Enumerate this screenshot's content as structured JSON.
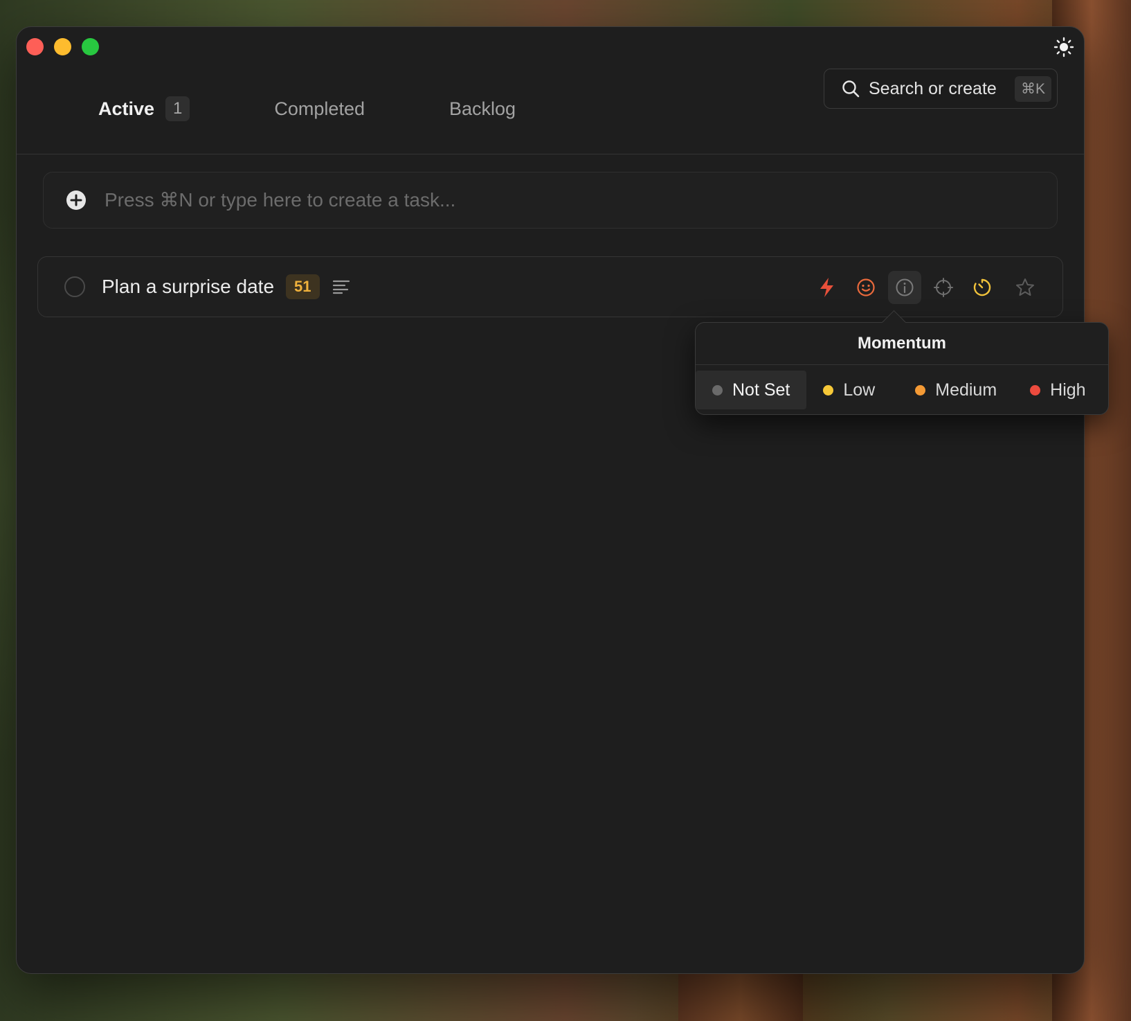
{
  "tabs": [
    {
      "label": "Active",
      "count": "1"
    },
    {
      "label": "Completed"
    },
    {
      "label": "Backlog"
    }
  ],
  "search": {
    "label": "Search or create",
    "shortcut": "⌘K"
  },
  "create": {
    "placeholder": "Press ⌘N or type here to create a task..."
  },
  "task": {
    "title": "Plan a surprise date",
    "badge": "51"
  },
  "task_actions": [
    {
      "icon": "bolt-icon",
      "color": "#e8503a"
    },
    {
      "icon": "smiley-icon",
      "color": "#ea6a3c"
    },
    {
      "icon": "momentum-gauge-icon",
      "color": "#7a7a7a",
      "selected": true
    },
    {
      "icon": "crosshair-icon",
      "color": "#6f6f6f"
    },
    {
      "icon": "timer-icon",
      "color": "#f2c33b"
    },
    {
      "icon": "star-icon",
      "color": "#5c5c5c"
    }
  ],
  "popover": {
    "title": "Momentum",
    "options": [
      {
        "label": "Not Set",
        "color": "#6a6a6a",
        "selected": true
      },
      {
        "label": "Low",
        "color": "#f6c838"
      },
      {
        "label": "Medium",
        "color": "#f49a35"
      },
      {
        "label": "High",
        "color": "#ec4b3e"
      }
    ]
  },
  "colors": {
    "window_bg": "#1e1e1e",
    "badge_text": "#f0b23c"
  }
}
